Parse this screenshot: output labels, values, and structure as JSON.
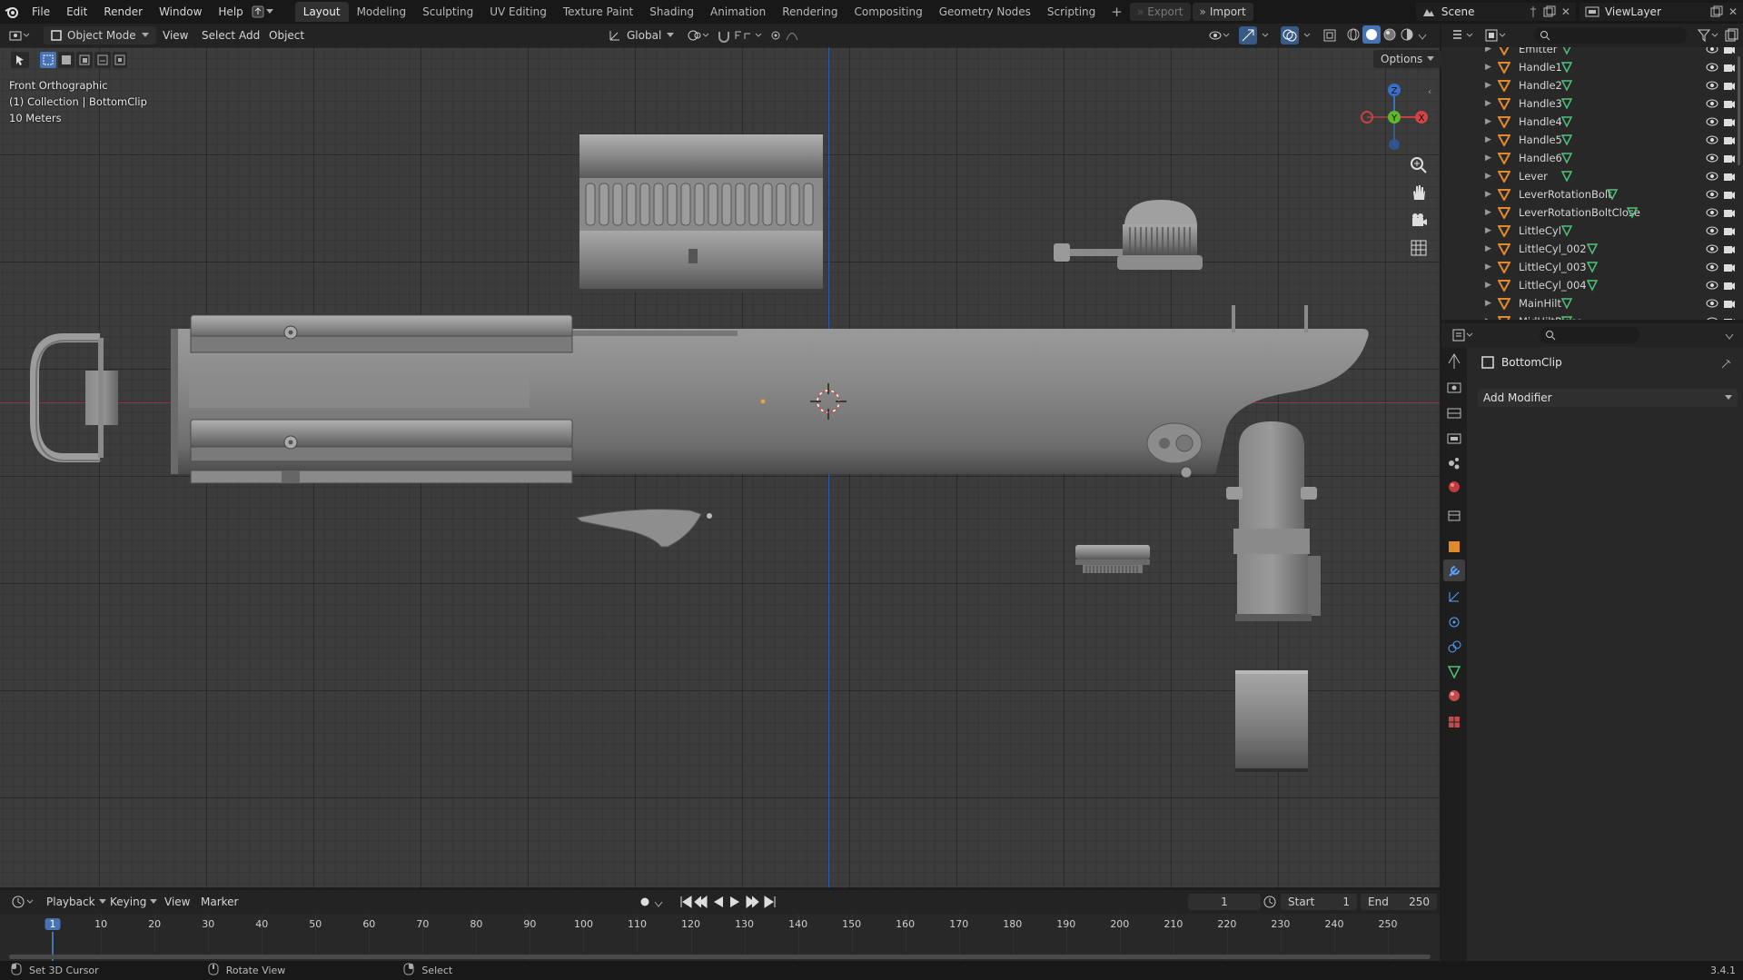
{
  "menu": {
    "items": [
      "File",
      "Edit",
      "Render",
      "Window",
      "Help"
    ],
    "workspaces": [
      "Layout",
      "Modeling",
      "Sculpting",
      "UV Editing",
      "Texture Paint",
      "Shading",
      "Animation",
      "Rendering",
      "Compositing",
      "Geometry Nodes",
      "Scripting"
    ],
    "active_workspace": "Layout",
    "export_label": "Export",
    "import_label": "Import",
    "scene": "Scene",
    "view_layer": "ViewLayer"
  },
  "viewport": {
    "mode": "Object Mode",
    "menus": [
      "View",
      "Select",
      "Add",
      "Object"
    ],
    "transform_orientation": "Global",
    "options_label": "Options",
    "view_name": "Front Orthographic",
    "collection_info": "(1) Collection | BottomClip",
    "scale_info": "10 Meters",
    "gizmo_axes": [
      "Z",
      "Y",
      "X"
    ]
  },
  "outliner": {
    "rows": [
      "Emitter",
      "Handle1",
      "Handle2",
      "Handle3",
      "Handle4",
      "Handle5",
      "Handle6",
      "Lever",
      "LeverRotationBolt",
      "LeverRotationBoltClose",
      "LittleCyl",
      "LittleCyl_002",
      "LittleCyl_003",
      "LittleCyl_004",
      "MainHilt",
      "MidHiltPiece"
    ]
  },
  "properties": {
    "object_name": "BottomClip",
    "add_modifier_label": "Add Modifier"
  },
  "timeline": {
    "menus": [
      "Playback",
      "Keying",
      "View",
      "Marker"
    ],
    "current_frame": "1",
    "start_label": "Start",
    "start": "1",
    "end_label": "End",
    "end": "250",
    "ticks": [
      "1",
      "10",
      "20",
      "30",
      "40",
      "50",
      "60",
      "70",
      "80",
      "90",
      "100",
      "110",
      "120",
      "130",
      "140",
      "150",
      "160",
      "170",
      "180",
      "190",
      "200",
      "210",
      "220",
      "230",
      "240",
      "250"
    ]
  },
  "status": {
    "items": [
      "Set 3D Cursor",
      "Rotate View",
      "Select"
    ],
    "version": "3.4.1"
  }
}
